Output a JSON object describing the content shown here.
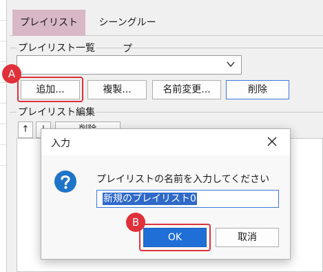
{
  "tabs": [
    {
      "label": "プレイリスト",
      "active": true
    },
    {
      "label": "シーングループ",
      "active": false
    }
  ],
  "playlist_list": {
    "group_label": "プレイリスト一覧",
    "combo_value": "",
    "buttons": {
      "add": "追加...",
      "duplicate": "複製...",
      "rename": "名前変更...",
      "delete": "削除"
    }
  },
  "playlist_edit": {
    "group_label": "プレイリスト編集",
    "tools": {
      "up": "↑",
      "down": "↓",
      "delete": "削除"
    }
  },
  "callouts": {
    "a": "A",
    "b": "B"
  },
  "dialog": {
    "title": "入力",
    "prompt": "プレイリストの名前を入力してください",
    "input_value": "新規のプレイリスト0",
    "ok_label": "OK",
    "cancel_label": "取消"
  },
  "colors": {
    "callout_red": "#e0303a",
    "accent_blue": "#1f6fd6",
    "active_tab_bg": "#d8b7c6",
    "question_icon": "#1d74c9"
  },
  "icons": {
    "combo_arrow": "chevron-down-icon",
    "dialog_close": "close-icon",
    "dialog_icon": "question-icon"
  }
}
